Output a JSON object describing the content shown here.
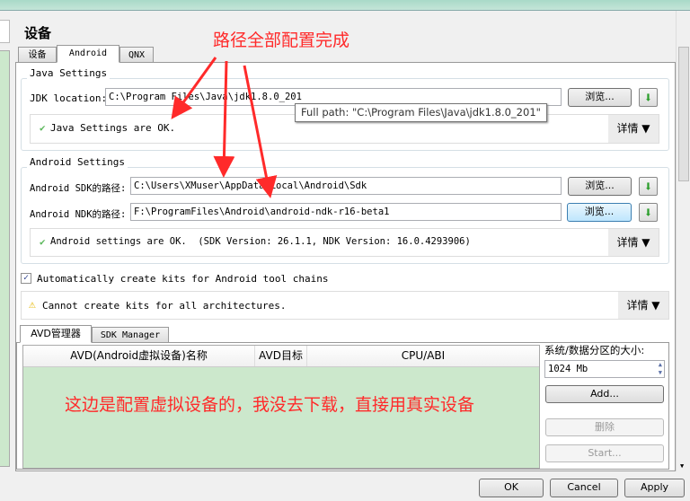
{
  "page_title": "设备",
  "tabs": [
    {
      "label": "设备"
    },
    {
      "label": "Android"
    },
    {
      "label": "QNX"
    }
  ],
  "java": {
    "group_label": "Java Settings",
    "jdk_label": "JDK location:",
    "jdk_value": "C:\\Program Files\\Java\\jdk1.8.0_201",
    "browse": "浏览...",
    "status": "Java Settings are OK.",
    "details": "详情",
    "tooltip": "Full path: \"C:\\Program Files\\Java\\jdk1.8.0_201\""
  },
  "android": {
    "group_label": "Android Settings",
    "sdk_label": "Android SDK的路径:",
    "sdk_value": "C:\\Users\\XMuser\\AppData\\Local\\Android\\Sdk",
    "ndk_label": "Android NDK的路径:",
    "ndk_value": "F:\\ProgramFiles\\Android\\android-ndk-r16-beta1",
    "browse": "浏览...",
    "status": "Android settings are OK.  (SDK Version: 26.1.1, NDK Version: 16.0.4293906)",
    "details": "详情"
  },
  "auto_kits": {
    "label": "Automatically create kits for Android tool chains",
    "checked": true
  },
  "warning": {
    "text": "Cannot create kits for all architectures.",
    "details": "详情"
  },
  "inner_tabs": [
    {
      "label": "AVD管理器"
    },
    {
      "label": "SDK Manager"
    }
  ],
  "avd_table": {
    "columns": [
      "AVD(Android虚拟设备)名称",
      "AVD目标",
      "CPU/ABI"
    ],
    "rows": []
  },
  "avd_side": {
    "size_label": "系统/数据分区的大小:",
    "size_value": "1024 Mb",
    "add": "Add...",
    "delete": "删除",
    "start": "Start..."
  },
  "footer": {
    "ok": "OK",
    "cancel": "Cancel",
    "apply": "Apply"
  },
  "annotations": {
    "top": "路径全部配置完成",
    "avd": "这边是配置虚拟设备的，我没去下载，直接用真实设备"
  },
  "colors": {
    "annotation": "#ff2a2a",
    "avd_body": "#cce8cc",
    "ok_check": "#5cb85c"
  }
}
